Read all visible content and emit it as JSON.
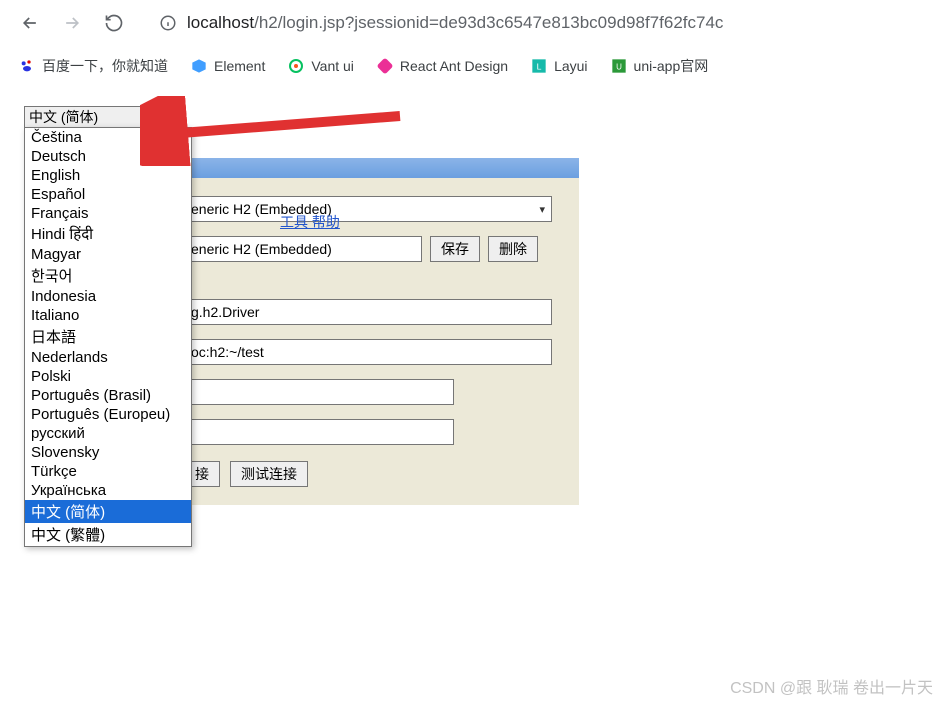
{
  "browser": {
    "url_prefix": "localhost",
    "url_path": "/h2/login.jsp?jsessionid=de93d3c6547e813bc09d98f7f62fc74c"
  },
  "bookmarks": [
    {
      "label": "百度一下，你就知道",
      "icon": "baidu",
      "color": "#2932e1"
    },
    {
      "label": "Element",
      "icon": "element",
      "color": "#409eff"
    },
    {
      "label": "Vant ui",
      "icon": "vant",
      "color": "#07c160"
    },
    {
      "label": "React Ant Design",
      "icon": "antd",
      "color": "#eb2f96"
    },
    {
      "label": "Layui",
      "icon": "layui",
      "color": "#16baaa"
    },
    {
      "label": "uni-app官网",
      "icon": "uniapp",
      "color": "#2b9939"
    }
  ],
  "lang": {
    "selected": "中文 (简体)",
    "options": [
      "Čeština",
      "Deutsch",
      "English",
      "Español",
      "Français",
      "Hindi हिंदी",
      "Magyar",
      "한국어",
      "Indonesia",
      "Italiano",
      "日本語",
      "Nederlands",
      "Polski",
      "Português (Brasil)",
      "Português (Europeu)",
      "русский",
      "Slovensky",
      "Türkçe",
      "Українська",
      "中文 (简体)",
      "中文 (繁體)"
    ],
    "highlighted_index": 19
  },
  "help_link": "工具   帮助",
  "form": {
    "saved_setting_visible": "eneric H2 (Embedded)",
    "setting_name_visible": "eneric H2 (Embedded)",
    "save_btn": "保存",
    "delete_btn": "删除",
    "driver_visible": "g.h2.Driver",
    "jdbc_visible": "oc:h2:~/test",
    "username": "",
    "password": "",
    "connect_visible": "接",
    "test_connection": "测试连接"
  },
  "watermark": "CSDN @跟 耿瑞 卷出一片天"
}
